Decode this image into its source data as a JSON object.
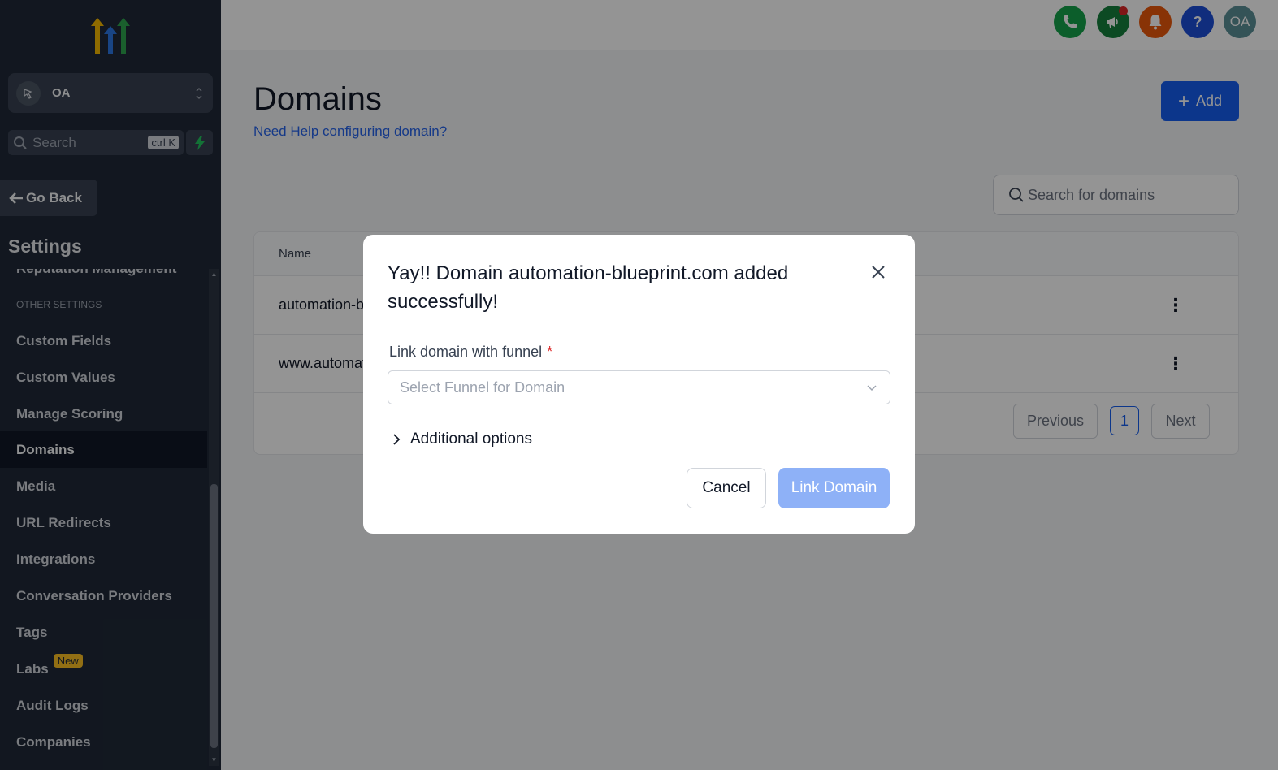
{
  "sidebar": {
    "location_name": "OA",
    "search_placeholder": "Search",
    "search_shortcut": "ctrl K",
    "go_back_label": "Go Back",
    "settings_title": "Settings",
    "partial_item": "Reputation Management",
    "section_label": "OTHER SETTINGS",
    "items": [
      {
        "label": "Custom Fields"
      },
      {
        "label": "Custom Values"
      },
      {
        "label": "Manage Scoring"
      },
      {
        "label": "Domains",
        "active": true
      },
      {
        "label": "Media"
      },
      {
        "label": "URL Redirects"
      },
      {
        "label": "Integrations"
      },
      {
        "label": "Conversation Providers"
      },
      {
        "label": "Tags"
      },
      {
        "label": "Labs",
        "badge": "New"
      },
      {
        "label": "Audit Logs"
      },
      {
        "label": "Companies"
      }
    ]
  },
  "header": {
    "icons": [
      {
        "name": "phone-icon",
        "color": "#16a34a"
      },
      {
        "name": "megaphone-icon",
        "color": "#15803d"
      },
      {
        "name": "bell-icon",
        "color": "#ea580c"
      },
      {
        "name": "help-icon",
        "color": "#1d4ed8"
      }
    ],
    "avatar_initials": "OA"
  },
  "main": {
    "title": "Domains",
    "help_link": "Need Help configuring domain?",
    "add_button": "Add",
    "search_placeholder": "Search for domains",
    "table": {
      "header_name": "Name",
      "rows": [
        {
          "name": "automation-blueprint.com"
        },
        {
          "name": "www.automation-blueprint.com"
        }
      ]
    },
    "pagination": {
      "previous": "Previous",
      "current_page": "1",
      "next": "Next"
    }
  },
  "modal": {
    "title": "Yay!! Domain automation-blueprint.com added successfully!",
    "field_label": "Link domain with funnel",
    "required_marker": "*",
    "select_placeholder": "Select Funnel for Domain",
    "additional_options": "Additional options",
    "cancel_label": "Cancel",
    "confirm_label": "Link Domain"
  },
  "colors": {
    "primary": "#155eef",
    "sidebar_bg": "#1f2937",
    "badge_new": "#fbbf24",
    "link_disabled": "#8eb1f7"
  }
}
